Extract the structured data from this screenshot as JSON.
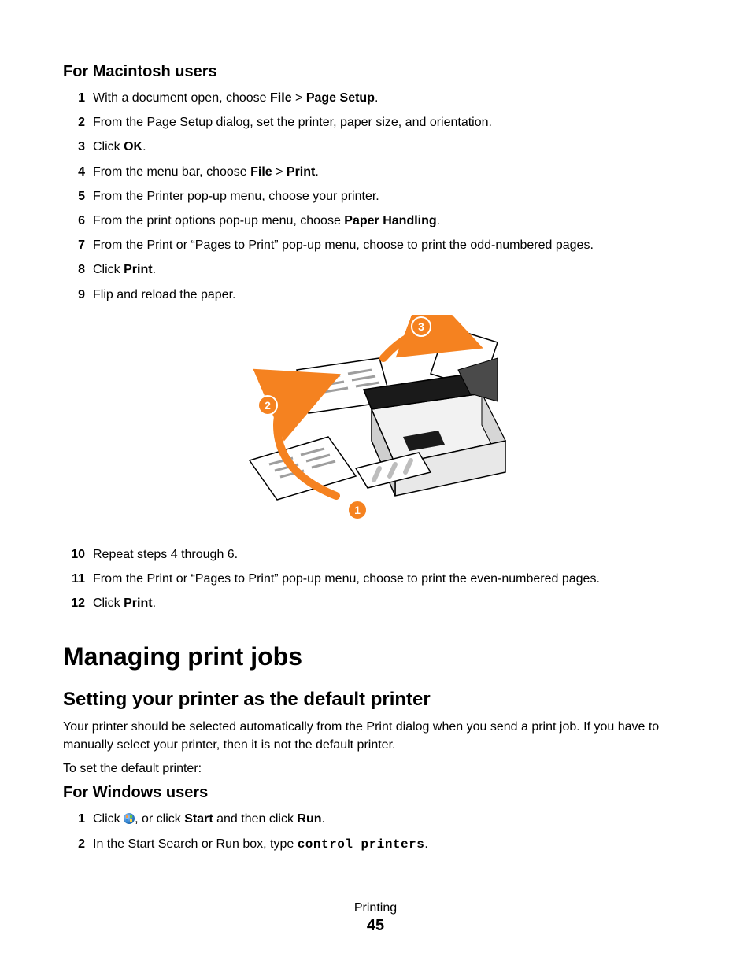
{
  "sectionMac": {
    "heading": "For Macintosh users",
    "steps": [
      {
        "n": "1",
        "parts": [
          {
            "t": "With a document open, choose "
          },
          {
            "t": "File",
            "b": true
          },
          {
            "t": " > "
          },
          {
            "t": "Page Setup",
            "b": true
          },
          {
            "t": "."
          }
        ]
      },
      {
        "n": "2",
        "parts": [
          {
            "t": "From the Page Setup dialog, set the printer, paper size, and orientation."
          }
        ]
      },
      {
        "n": "3",
        "parts": [
          {
            "t": "Click "
          },
          {
            "t": "OK",
            "b": true
          },
          {
            "t": "."
          }
        ]
      },
      {
        "n": "4",
        "parts": [
          {
            "t": "From the menu bar, choose "
          },
          {
            "t": "File",
            "b": true
          },
          {
            "t": " > "
          },
          {
            "t": "Print",
            "b": true
          },
          {
            "t": "."
          }
        ]
      },
      {
        "n": "5",
        "parts": [
          {
            "t": "From the Printer pop-up menu, choose your printer."
          }
        ]
      },
      {
        "n": "6",
        "parts": [
          {
            "t": "From the print options pop-up menu, choose "
          },
          {
            "t": "Paper Handling",
            "b": true
          },
          {
            "t": "."
          }
        ]
      },
      {
        "n": "7",
        "parts": [
          {
            "t": "From the Print or “Pages to Print” pop-up menu, choose to print the odd-numbered pages."
          }
        ]
      },
      {
        "n": "8",
        "parts": [
          {
            "t": "Click "
          },
          {
            "t": "Print",
            "b": true
          },
          {
            "t": "."
          }
        ]
      },
      {
        "n": "9",
        "parts": [
          {
            "t": "Flip and reload the paper."
          }
        ]
      }
    ],
    "stepsAfter": [
      {
        "n": "10",
        "parts": [
          {
            "t": "Repeat steps 4 through 6."
          }
        ]
      },
      {
        "n": "11",
        "parts": [
          {
            "t": "From the Print or “Pages to Print” pop-up menu, choose to print the even-numbered pages."
          }
        ]
      },
      {
        "n": "12",
        "parts": [
          {
            "t": "Click "
          },
          {
            "t": "Print",
            "b": true
          },
          {
            "t": "."
          }
        ]
      }
    ]
  },
  "figure": {
    "callouts": [
      "1",
      "2",
      "3"
    ]
  },
  "h1": "Managing print jobs",
  "h2": "Setting your printer as the default printer",
  "para1": "Your printer should be selected automatically from the Print dialog when you send a print job. If you have to manually select your printer, then it is not the default printer.",
  "para2": "To set the default printer:",
  "sectionWin": {
    "heading": "For Windows users",
    "steps": [
      {
        "n": "1",
        "parts": [
          {
            "t": "Click "
          },
          {
            "icon": "windows"
          },
          {
            "t": ", or click "
          },
          {
            "t": "Start",
            "b": true
          },
          {
            "t": " and then click "
          },
          {
            "t": "Run",
            "b": true
          },
          {
            "t": "."
          }
        ]
      },
      {
        "n": "2",
        "parts": [
          {
            "t": "In the Start Search or Run box, type "
          },
          {
            "t": "control printers",
            "mono": true
          },
          {
            "t": "."
          }
        ]
      }
    ]
  },
  "footer": {
    "chapter": "Printing",
    "page": "45"
  }
}
